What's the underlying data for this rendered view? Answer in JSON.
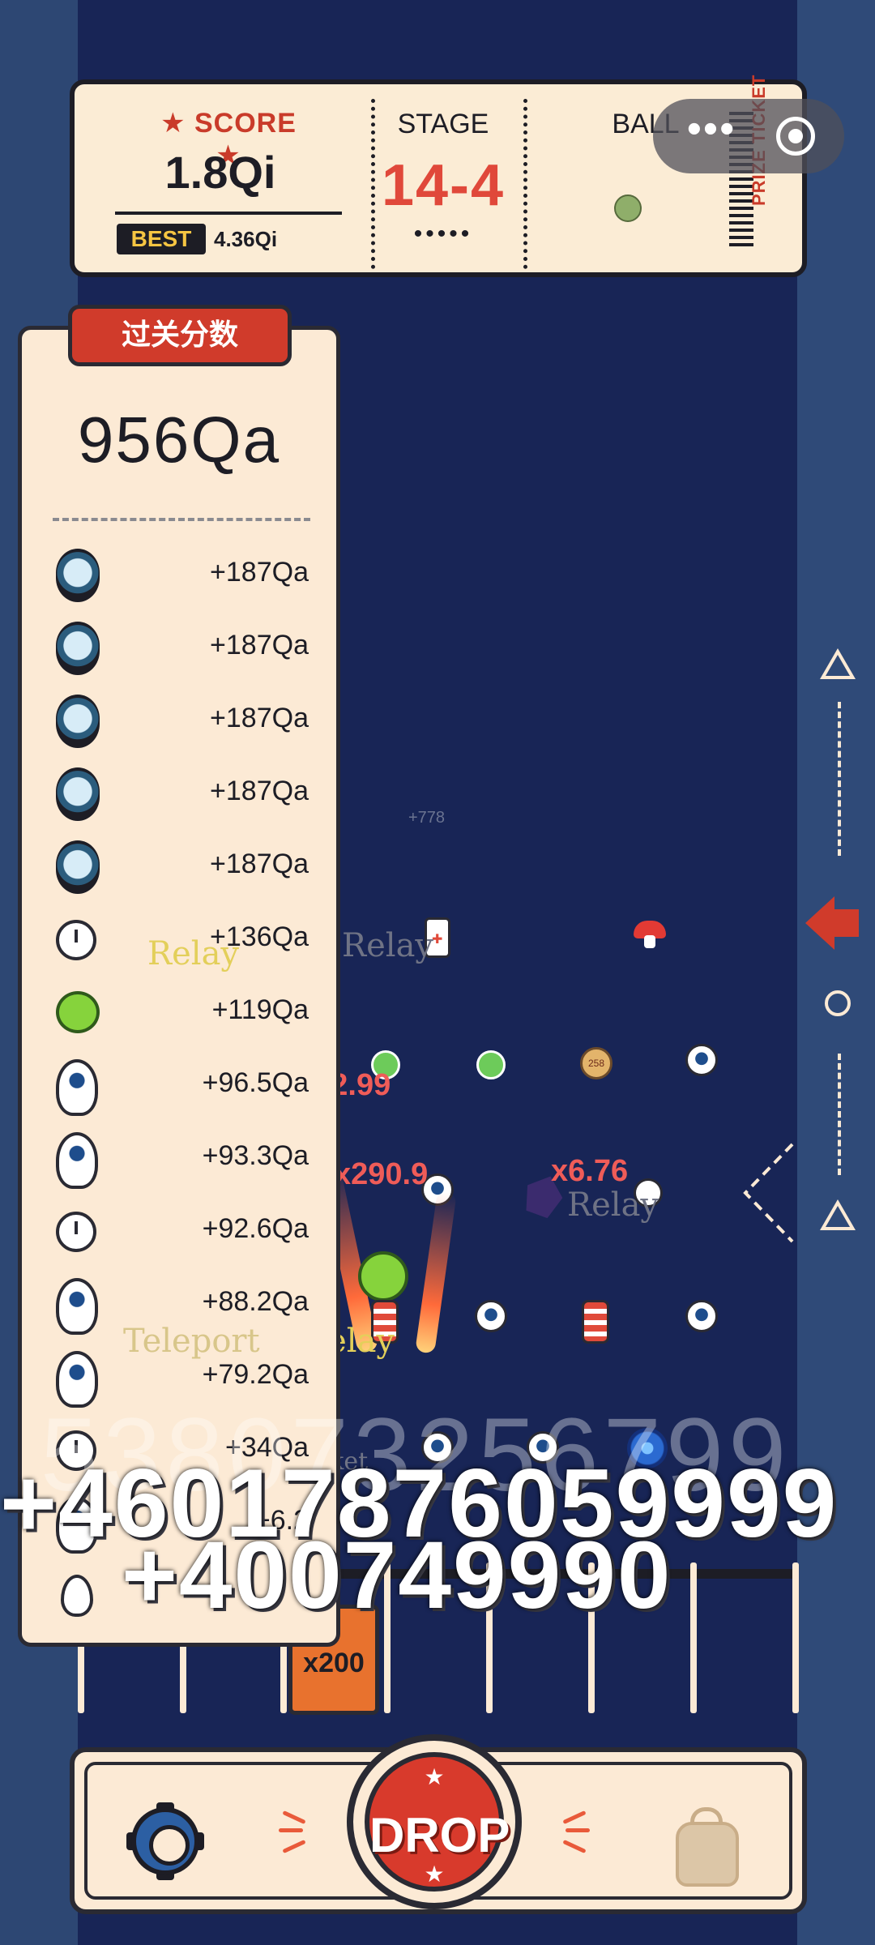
{
  "hud": {
    "score_label": "★ SCORE ★",
    "score_value": "1.8Qi",
    "best_label": "BEST",
    "best_value": "4.36Qi",
    "stage_label": "STAGE",
    "stage_value": "14-4",
    "stage_dots": "•••••",
    "ball_label": "BALL",
    "prize_text": "PRIZE TICKET"
  },
  "capsule": {
    "more_glyph": "•••"
  },
  "panel": {
    "title": "过关分数",
    "total": "956Qa",
    "items": [
      {
        "icon": "mirror-icon",
        "value": "+187Qa"
      },
      {
        "icon": "mirror-icon",
        "value": "+187Qa"
      },
      {
        "icon": "mirror-icon",
        "value": "+187Qa"
      },
      {
        "icon": "mirror-icon",
        "value": "+187Qa"
      },
      {
        "icon": "mirror-icon",
        "value": "+187Qa"
      },
      {
        "icon": "clock-icon",
        "value": "+136Qa"
      },
      {
        "icon": "slime-icon",
        "value": "+119Qa"
      },
      {
        "icon": "eyeball-icon",
        "value": "+96.5Qa"
      },
      {
        "icon": "eyeball-icon",
        "value": "+93.3Qa"
      },
      {
        "icon": "clock-icon",
        "value": "+92.6Qa"
      },
      {
        "icon": "eyeball-icon",
        "value": "+88.2Qa"
      },
      {
        "icon": "eyeball-icon",
        "value": "+79.2Qa"
      },
      {
        "icon": "clock-icon",
        "value": "+34Qa"
      },
      {
        "icon": "eyeball-icon",
        "value": "+6.2"
      },
      {
        "icon": "egg-icon",
        "value": ""
      }
    ]
  },
  "field": {
    "relay_label": "Relay",
    "teleport_label": "Teleport",
    "bucket_label": "Bucket",
    "small_score": "+778",
    "coin_value": "258",
    "mult_1": "x42.99",
    "mult_2": "x290.9",
    "mult_3": "x6.76",
    "popup_ghost": "538073256799",
    "popup_1": "+46017876059999",
    "popup_2": "+400749990",
    "bucket_multiplier": "x200"
  },
  "controls": {
    "drop_label": "DROP",
    "star": "★"
  },
  "colors": {
    "field_bg": "#182556",
    "side_bg": "#2d4773",
    "panel_bg": "#fcead5",
    "accent_red": "#d03b2b",
    "outline": "#2a2a33"
  }
}
